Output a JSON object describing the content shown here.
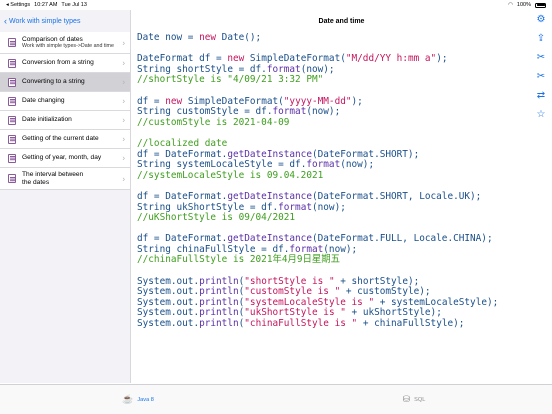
{
  "status": {
    "back_app": "Settings",
    "time": "10:27 AM",
    "date": "Tue Jul 13",
    "battery": "100%"
  },
  "sidebar": {
    "back_label": "Work with simple types",
    "items": [
      {
        "label": "Comparison of dates",
        "sub": "Work with simple types->Date and time"
      },
      {
        "label": "Conversion from a string"
      },
      {
        "label": "Converting to a string"
      },
      {
        "label": "Date changing"
      },
      {
        "label": "Date initialization"
      },
      {
        "label": "Getting of the current date"
      },
      {
        "label": "Getting of year, month, day"
      },
      {
        "label": "The interval between\nthe dates"
      }
    ],
    "active_index": 2
  },
  "header": {
    "title": "Date and time"
  },
  "toolbar": {
    "icons": [
      "gear-icon",
      "share-icon",
      "scissors-icon",
      "scissors-icon-2",
      "link-icon",
      "star-icon"
    ]
  },
  "code_lines": [
    [
      [
        "ty",
        "Date"
      ],
      [
        "pl",
        " now = "
      ],
      [
        "kw",
        "new"
      ],
      [
        "pl",
        " Date();"
      ]
    ],
    [],
    [
      [
        "ty",
        "DateFormat"
      ],
      [
        "pl",
        " df = "
      ],
      [
        "kw",
        "new"
      ],
      [
        "pl",
        " SimpleDateFormat("
      ],
      [
        "str",
        "\"M/dd/YY h:mm a\""
      ],
      [
        "pl",
        ");"
      ]
    ],
    [
      [
        "ty",
        "String"
      ],
      [
        "pl",
        " shortStyle = df."
      ],
      [
        "fn",
        "format"
      ],
      [
        "pl",
        "(now);"
      ]
    ],
    [
      [
        "com",
        "//shortStyle is \"4/09/21 3:32 PM\""
      ]
    ],
    [],
    [
      [
        "pl",
        "df = "
      ],
      [
        "kw",
        "new"
      ],
      [
        "pl",
        " SimpleDateFormat("
      ],
      [
        "str",
        "\"yyyy-MM-dd\""
      ],
      [
        "pl",
        ");"
      ]
    ],
    [
      [
        "ty",
        "String"
      ],
      [
        "pl",
        " customStyle = df."
      ],
      [
        "fn",
        "format"
      ],
      [
        "pl",
        "(now);"
      ]
    ],
    [
      [
        "com",
        "//customStyle is 2021-04-09"
      ]
    ],
    [],
    [
      [
        "com",
        "//localized date"
      ]
    ],
    [
      [
        "pl",
        "df = DateFormat."
      ],
      [
        "fn",
        "getDateInstance"
      ],
      [
        "pl",
        "(DateFormat.SHORT);"
      ]
    ],
    [
      [
        "ty",
        "String"
      ],
      [
        "pl",
        " systemLocaleStyle = df."
      ],
      [
        "fn",
        "format"
      ],
      [
        "pl",
        "(now);"
      ]
    ],
    [
      [
        "com",
        "//systemLocaleStyle is 09.04.2021"
      ]
    ],
    [],
    [
      [
        "pl",
        "df = DateFormat."
      ],
      [
        "fn",
        "getDateInstance"
      ],
      [
        "pl",
        "(DateFormat.SHORT, Locale.UK);"
      ]
    ],
    [
      [
        "ty",
        "String"
      ],
      [
        "pl",
        " ukShortStyle = df."
      ],
      [
        "fn",
        "format"
      ],
      [
        "pl",
        "(now);"
      ]
    ],
    [
      [
        "com",
        "//uKShortStyle is 09/04/2021"
      ]
    ],
    [],
    [
      [
        "pl",
        "df = DateFormat."
      ],
      [
        "fn",
        "getDateInstance"
      ],
      [
        "pl",
        "(DateFormat.FULL, Locale.CHINA);"
      ]
    ],
    [
      [
        "ty",
        "String"
      ],
      [
        "pl",
        " chinaFullStyle = df."
      ],
      [
        "fn",
        "format"
      ],
      [
        "pl",
        "(now);"
      ]
    ],
    [
      [
        "com",
        "//chinaFullStyle is 2021年4月9日星期五"
      ]
    ],
    [],
    [
      [
        "ty",
        "System"
      ],
      [
        "pl",
        ".out."
      ],
      [
        "fn",
        "println"
      ],
      [
        "pl",
        "("
      ],
      [
        "str",
        "\"shortStyle is \""
      ],
      [
        "pl",
        " + shortStyle);"
      ]
    ],
    [
      [
        "ty",
        "System"
      ],
      [
        "pl",
        ".out."
      ],
      [
        "fn",
        "println"
      ],
      [
        "pl",
        "("
      ],
      [
        "str",
        "\"customStyle is \""
      ],
      [
        "pl",
        " + customStyle);"
      ]
    ],
    [
      [
        "ty",
        "System"
      ],
      [
        "pl",
        ".out."
      ],
      [
        "fn",
        "println"
      ],
      [
        "pl",
        "("
      ],
      [
        "str",
        "\"systemLocaleStyle is \""
      ],
      [
        "pl",
        " + systemLocaleStyle);"
      ]
    ],
    [
      [
        "ty",
        "System"
      ],
      [
        "pl",
        ".out."
      ],
      [
        "fn",
        "println"
      ],
      [
        "pl",
        "("
      ],
      [
        "str",
        "\"ukShortStyle is \""
      ],
      [
        "pl",
        " + ukShortStyle);"
      ]
    ],
    [
      [
        "ty",
        "System"
      ],
      [
        "pl",
        ".out."
      ],
      [
        "fn",
        "println"
      ],
      [
        "pl",
        "("
      ],
      [
        "str",
        "\"chinaFullStyle is \""
      ],
      [
        "pl",
        " + chinaFullStyle);"
      ]
    ]
  ],
  "tabs": [
    {
      "label": "Java 8",
      "icon": "java-cup-icon",
      "active": true
    },
    {
      "label": "SQL",
      "icon": "database-icon",
      "active": false
    }
  ]
}
